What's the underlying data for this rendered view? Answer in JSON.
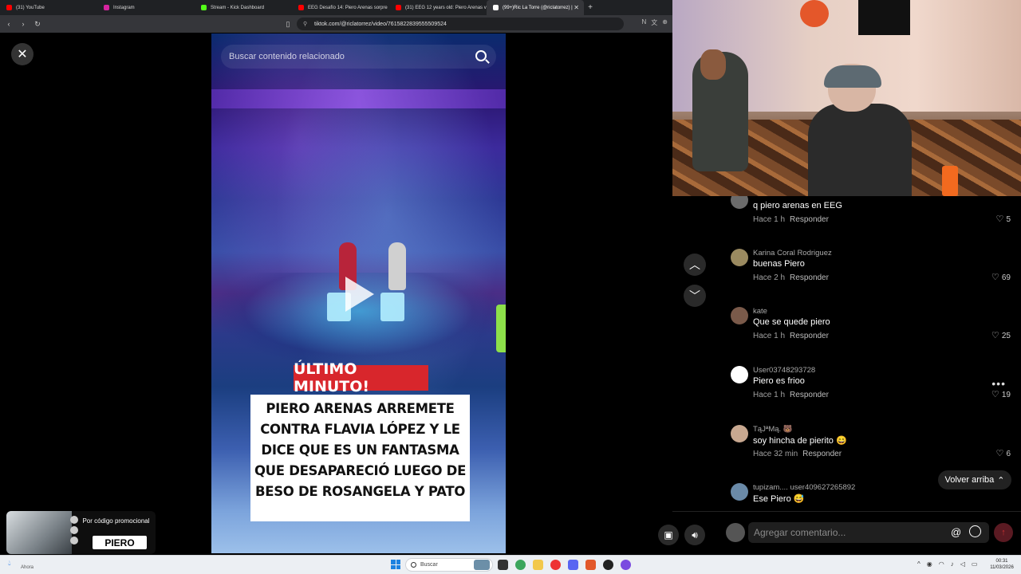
{
  "browser": {
    "tabs": [
      {
        "label": "(31) YouTube",
        "color": "#ff0000"
      },
      {
        "label": "Instagram",
        "color": "#d6249f"
      },
      {
        "label": "Stream - Kick Dashboard",
        "color": "#53fc18"
      },
      {
        "label": "EEG Desafío 14: Piero Arenas sorpre",
        "color": "#ff0000"
      },
      {
        "label": "(31) EEG 12 years old: Piero Arenas v",
        "color": "#ff0000"
      },
      {
        "label": "(99+)Ric La Torre (@riclatorrez) |",
        "color": "#ffffff",
        "active": true
      }
    ],
    "url": "tiktok.com/@riclatorrez/video/7615822839555509524"
  },
  "video": {
    "search_placeholder": "Buscar contenido relacionado",
    "urgent_label": "ÚLTIMO MINUTO!",
    "headline": "Piero Arenas arremete contra Flavia López y le dice que es un fantasma que desapareció luego de beso de Rosangela y Pato"
  },
  "comments": [
    {
      "user": "",
      "text": "q piero arenas en EEG",
      "time": "Hace 1 h",
      "reply": "Responder",
      "likes": "5",
      "avatar_color": "#6b6b6b"
    },
    {
      "user": "Karina Coral Rodriguez",
      "text": "buenas Piero",
      "time": "Hace 2 h",
      "reply": "Responder",
      "likes": "69",
      "avatar_color": "#9a8a60"
    },
    {
      "user": "kate",
      "text": "Que se quede piero",
      "time": "Hace 1 h",
      "reply": "Responder",
      "likes": "25",
      "avatar_color": "#7a5a4a"
    },
    {
      "user": "User03748293728",
      "text": "Piero es frioo",
      "time": "Hace 1 h",
      "reply": "Responder",
      "likes": "19",
      "avatar_color": "#ffffff"
    },
    {
      "user": "TąJªMą. 🐻",
      "text": "soy hincha de pierito 😄",
      "time": "Hace 32 min",
      "reply": "Responder",
      "likes": "6",
      "avatar_color": "#c8a890"
    },
    {
      "user": "tupizam.... user409627265892",
      "text": "Ese Piero 😅",
      "time": "",
      "reply": "",
      "likes": "",
      "avatar_color": "#6a8aa8"
    }
  ],
  "back_to_top": "Volver arriba",
  "comment_input_placeholder": "Agregar comentario...",
  "promo": {
    "text": "Por código promocional",
    "code": "PIERO"
  },
  "taskbar": {
    "weather": "Ahora",
    "search_placeholder": "Buscar",
    "time": "00:31",
    "date": "11/03/2026"
  },
  "colors": {
    "accent_red": "#fe2c55",
    "urgent_red": "#d8262c"
  }
}
